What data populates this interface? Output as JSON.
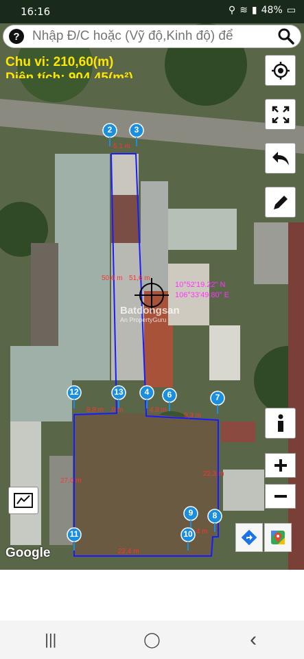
{
  "status": {
    "time": "16:16",
    "battery": "48%"
  },
  "search": {
    "placeholder": "Nhập Đ/C hoặc (Vỹ độ,Kinh độ) để"
  },
  "measure": {
    "perimeter": "Chu vi: 210,60(m)",
    "area": "Diện tích: 904,45(m²)"
  },
  "coords": {
    "lat": "10°52'19.22\" N",
    "lng": "106°33'49.80\" E"
  },
  "markers": [
    "2",
    "3",
    "4",
    "6",
    "7",
    "8",
    "9",
    "10",
    "11",
    "12",
    "13"
  ],
  "edges": {
    "top": "5,1 m",
    "left_long": "50,6 m",
    "right_long": "51,6 m",
    "mid_left": "8,8 m",
    "mid_small": ",0 m",
    "mid_small2": "4,8 m",
    "mid_right": "9,3 m",
    "left_lower": "27,0 m",
    "right_lower": "22,3 m",
    "bottom": "22,4 m",
    "small_right": "4 m"
  },
  "watermark": {
    "text": "Batdongsan",
    "sub": "An PropertyGuru"
  },
  "google_label": "Google",
  "nav": {
    "recent": "|||",
    "home": "◯",
    "back": "‹"
  },
  "colors": {
    "accent_boundary": "#1a1aff",
    "marker": "#1a8fe0",
    "measure_text": "#ffe600",
    "coords_text": "#ff33ff"
  }
}
